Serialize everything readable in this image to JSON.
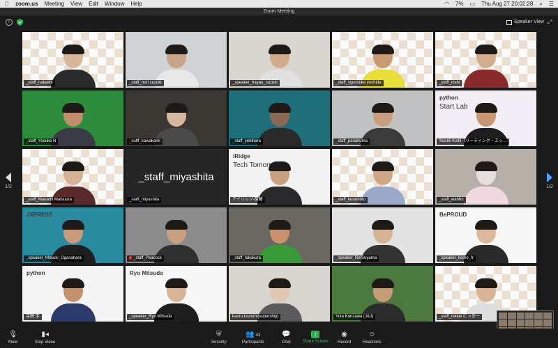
{
  "menubar": {
    "app": "zoom.us",
    "items": [
      "Meeting",
      "View",
      "Edit",
      "Window",
      "Help"
    ],
    "battery": "7%",
    "clock": "Thu Aug 27  20:02:28"
  },
  "window": {
    "title": "Zoom Meeting"
  },
  "top": {
    "speaker_view": "Speaker View"
  },
  "pager": {
    "prev": "1/2",
    "next": "1/2"
  },
  "tiles": [
    {
      "name": "_staff_nakashi",
      "bg": "checker",
      "skin": "#d8b79c",
      "shirt": "#2a2a2a"
    },
    {
      "name": "_staff_nori suzuki",
      "bg": "#cfd3d6",
      "skin": "#c9a385",
      "shirt": "#e8e8e8"
    },
    {
      "name": "_speaker_hayao_suzuki",
      "bg": "#d9d6d0",
      "skin": "#d2ab8c",
      "shirt": "#e0e0e0"
    },
    {
      "name": "_staff_syunsuke yoshida",
      "bg": "checker",
      "skin": "#c99a74",
      "shirt": "#e8de3a",
      "active": true
    },
    {
      "name": "_staff_nishi",
      "bg": "checker",
      "skin": "#d3ad90",
      "shirt": "#8b2a2a"
    },
    {
      "name": "_staff_Yosuke N",
      "bg": "#2d8c3c",
      "skin": "#c08e6c",
      "shirt": "#3a3a46"
    },
    {
      "name": "_sutff_kawakami",
      "bg": "#3b3834",
      "skin": "#d6b89e",
      "shirt": "#4a4a4a"
    },
    {
      "name": "_staff_yebihara",
      "bg": "#1f6f7a",
      "skin": "#8a6a55",
      "shirt": "#2a2a2a"
    },
    {
      "name": "_staff_panakuma",
      "bg": "#bfc1c2",
      "skin": "#c79e80",
      "shirt": "#3b3b3b"
    },
    {
      "name": "Yasuki Kishi（リーディング・エッ…",
      "bg": "#f3eef6",
      "skin": "#c99676",
      "shirt": "#1e1e1e",
      "text1": "python",
      "text2": "Start Lab"
    },
    {
      "name": "_staff_Manami Matsuura",
      "bg": "checker",
      "skin": "#d5b197",
      "shirt": "#5a2a2a"
    },
    {
      "name": "_staff_miyashita",
      "bg": "name-only",
      "big": "_staff_miyashita"
    },
    {
      "name": "アイリッジ-斎藤",
      "bg": "#f2f2f2",
      "skin": "#c9a080",
      "shirt": "#2a2a2a",
      "text1": "iRidge",
      "text2": "Tech Tomorrow"
    },
    {
      "name": "_staff_kuramoto",
      "bg": "checker",
      "skin": "#d0a887",
      "shirt": "#9aa9c7"
    },
    {
      "name": "_staff_wahho",
      "bg": "#b7b0a8",
      "skin": "#e6e0dc",
      "shirt": "#f0d8e0"
    },
    {
      "name": "_speaker_Mitsuki_Ogasahara",
      "bg": "#2a8aa0",
      "skin": "#c79a7a",
      "shirt": "#1e1e1e",
      "text1": "JXPRESS"
    },
    {
      "name": "_staff_Peacock",
      "bg": "#8c8c8c",
      "skin": "#c9a182",
      "shirt": "#2f2f2f",
      "mic_off": true
    },
    {
      "name": "_staff_takakura",
      "bg": "#6a6661",
      "skin": "#c7936f",
      "shirt": "#3a9a3a"
    },
    {
      "name": "_speaker_ReiSuyama",
      "bg": "#e2e2e2",
      "skin": "#d6b294",
      "shirt": "#333"
    },
    {
      "name": "_speaker_komo_fr",
      "bg": "#f7f7f7",
      "skin": "#dcb89c",
      "shirt": "#2a2a2a",
      "text1": "BePROUD"
    },
    {
      "name": "寺田 学",
      "bg": "#f4f4f4",
      "skin": "#c5916c",
      "shirt": "#2a3a6a",
      "text1": "python"
    },
    {
      "name": "_speaker_Ryo Mitsuda",
      "bg": "#f7f7f7",
      "skin": "#d7b497",
      "shirt": "#1e1e1e",
      "text1": "Ryo Mitsuda"
    },
    {
      "name": "kaoru.tsurumi(supership)",
      "bg": "#d8d4ce",
      "skin": "#e1c6b2",
      "shirt": "#5b5b5b"
    },
    {
      "name": "Yuta Kanzawa (J&J)",
      "bg": "#4c7a3e",
      "skin": "#c79b78",
      "shirt": "#2c2c2c"
    },
    {
      "name": "_staff_nikkie にっきー",
      "bg": "checker",
      "skin": "#d8b396",
      "shirt": "#ddd"
    }
  ],
  "toolbar": {
    "mute": "Mute",
    "stop_video": "Stop Video",
    "security": "Security",
    "participants": "Participants",
    "participants_count": "43",
    "chat": "Chat",
    "share_screen": "Share Screen",
    "record": "Record",
    "reactions": "Reactions"
  },
  "colors": {
    "active_border": "#f5d94a",
    "share_green": "#2bb24c"
  }
}
